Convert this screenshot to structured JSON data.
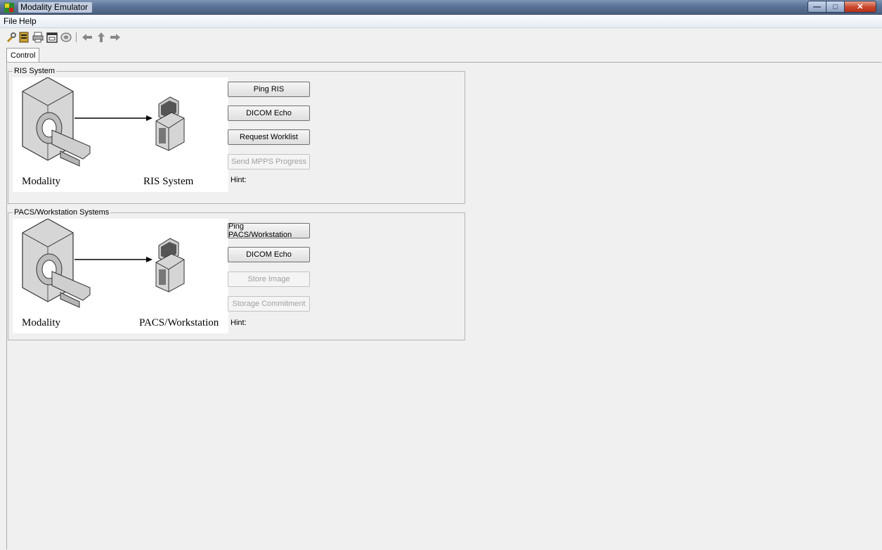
{
  "window": {
    "title": "Modality Emulator",
    "icon": "modality-app-icon"
  },
  "menu": {
    "items": [
      "File",
      "Help"
    ]
  },
  "toolbar": {
    "icons": [
      "tools-icon",
      "notebook-icon",
      "printer-icon",
      "calendar-icon",
      "disc-icon",
      "back-arrow-icon",
      "up-arrow-icon",
      "forward-arrow-icon"
    ]
  },
  "tabs": [
    {
      "label": "Control",
      "active": true
    }
  ],
  "ris": {
    "group_title": "RIS System",
    "left_label": "Modality",
    "right_label": "RIS System",
    "buttons": [
      {
        "label": "Ping RIS",
        "enabled": true
      },
      {
        "label": "DICOM Echo",
        "enabled": true
      },
      {
        "label": "Request Worklist",
        "enabled": true
      },
      {
        "label": "Send MPPS Progress",
        "enabled": false
      }
    ],
    "hint": "Hint:"
  },
  "pacs": {
    "group_title": "PACS/Workstation Systems",
    "left_label": "Modality",
    "right_label": "PACS/Workstation",
    "buttons": [
      {
        "label": "Ping PACS/Workstation",
        "enabled": true
      },
      {
        "label": "DICOM Echo",
        "enabled": true
      },
      {
        "label": "Store Image",
        "enabled": false
      },
      {
        "label": "Storage Commitment",
        "enabled": false
      }
    ],
    "hint": "Hint:"
  },
  "colors": {
    "titlebar": "#5b7396",
    "close_button": "#c6452b",
    "disabled_text": "#a0a0a0"
  }
}
